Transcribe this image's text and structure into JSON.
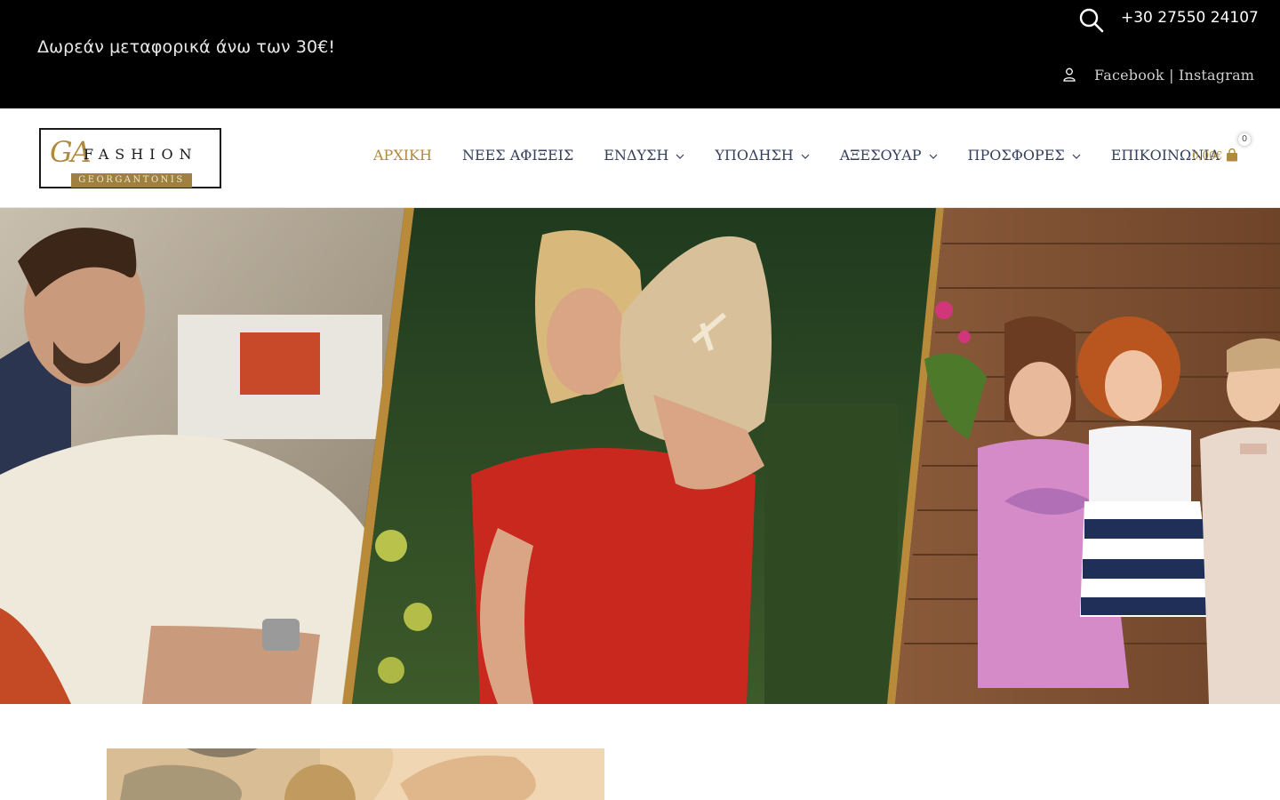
{
  "topbar": {
    "promo_text": "Δωρεάν μεταφορικά άνω των 30€!",
    "phone": "+30 27550 24107",
    "social_facebook": "Facebook",
    "social_separator": " | ",
    "social_instagram": "Instagram",
    "icons": [
      "search-icon",
      "user-icon"
    ]
  },
  "header": {
    "logo": {
      "ga": "GA",
      "fashion": "FASHION",
      "sub": "GEORGANTONIS"
    },
    "nav": [
      {
        "label": "ΑΡΧΙΚΗ",
        "active": true,
        "dropdown": false
      },
      {
        "label": "ΝΕΕΣ ΑΦΙΞΕΙΣ",
        "active": false,
        "dropdown": false
      },
      {
        "label": "ΕΝΔΥΣΗ",
        "active": false,
        "dropdown": true
      },
      {
        "label": "ΥΠΟΔΗΣΗ",
        "active": false,
        "dropdown": true
      },
      {
        "label": "ΑΞΕΣΟΥΑΡ",
        "active": false,
        "dropdown": true
      },
      {
        "label": "ΠΡΟΣΦΟΡΕΣ",
        "active": false,
        "dropdown": true
      },
      {
        "label": "ΕΠΙΚΟΙΝΩΝΙΑ",
        "active": false,
        "dropdown": false
      }
    ],
    "cart": {
      "total": "0,00€",
      "count": "0"
    }
  },
  "colors": {
    "accent": "#b08a3e",
    "nav_text": "#34405b",
    "topbar_bg": "#000000"
  }
}
